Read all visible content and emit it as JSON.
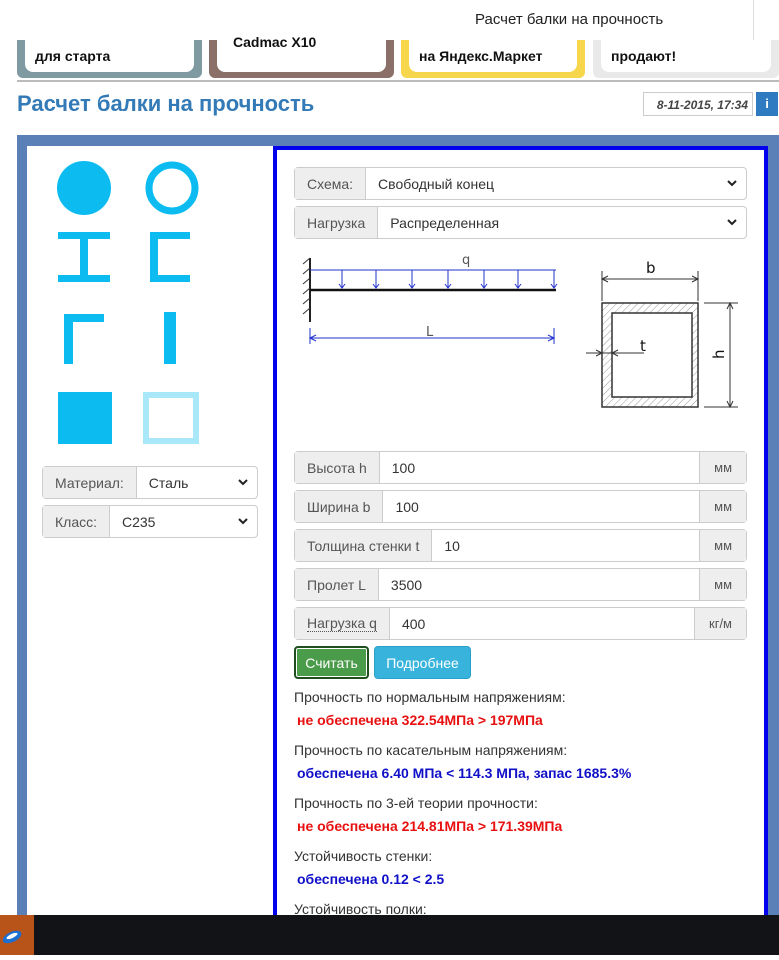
{
  "window": {
    "title": "Расчет балки на прочность"
  },
  "ads": [
    {
      "text": "для старта"
    },
    {
      "text": "Cadmac X10"
    },
    {
      "text": "на Яндекс.Маркет"
    },
    {
      "text": "продают!"
    }
  ],
  "header": {
    "title": "Расчет балки на прочность",
    "date": "8-11-2015, 17:34",
    "info_label": "i"
  },
  "left": {
    "material": {
      "label": "Материал:",
      "value": "Сталь"
    },
    "class": {
      "label": "Класс:",
      "value": "С235"
    }
  },
  "form": {
    "scheme": {
      "label": "Схема:",
      "value": "Свободный конец"
    },
    "load_type": {
      "label": "Нагрузка",
      "value": "Распределенная"
    },
    "height": {
      "label": "Высота h",
      "value": "100",
      "unit": "мм"
    },
    "width": {
      "label": "Ширина b",
      "value": "100",
      "unit": "мм"
    },
    "thickness": {
      "label": "Толщина стенки t",
      "value": "10",
      "unit": "мм"
    },
    "span": {
      "label": "Пролет L",
      "value": "3500",
      "unit": "мм"
    },
    "load_q": {
      "label": "Нагрузка q",
      "value": "400",
      "unit": "кг/м"
    },
    "calc_button": "Считать",
    "more_button": "Подробнее"
  },
  "diagram": {
    "q_label": "q",
    "L_label": "L",
    "b_label": "b",
    "t_label": "t",
    "h_label": "h"
  },
  "results": [
    {
      "label": "Прочность по нормальным напряжениям:",
      "value": "не обеспечена 322.54МПа > 197МПа",
      "status": "bad"
    },
    {
      "label": "Прочность по касательным напряжениям:",
      "value": "обеспечена 6.40 МПа < 114.3 МПа, запас 1685.3%",
      "status": "good"
    },
    {
      "label": "Прочность по 3-ей теории прочности:",
      "value": "не обеспечена 214.81МПа > 171.39МПа",
      "status": "bad"
    },
    {
      "label": "Устойчивость стенки:",
      "value": "обеспечена 0.12 < 2.5",
      "status": "good"
    },
    {
      "label": "Устойчивость полки:",
      "value": "",
      "status": ""
    }
  ],
  "colors": {
    "shape": "#0cbcf0",
    "shape_light": "#a8e8f8",
    "frame": "#5b80b8",
    "panel_border": "#0000ee",
    "bad": "#e81010",
    "good": "#1010c8"
  }
}
